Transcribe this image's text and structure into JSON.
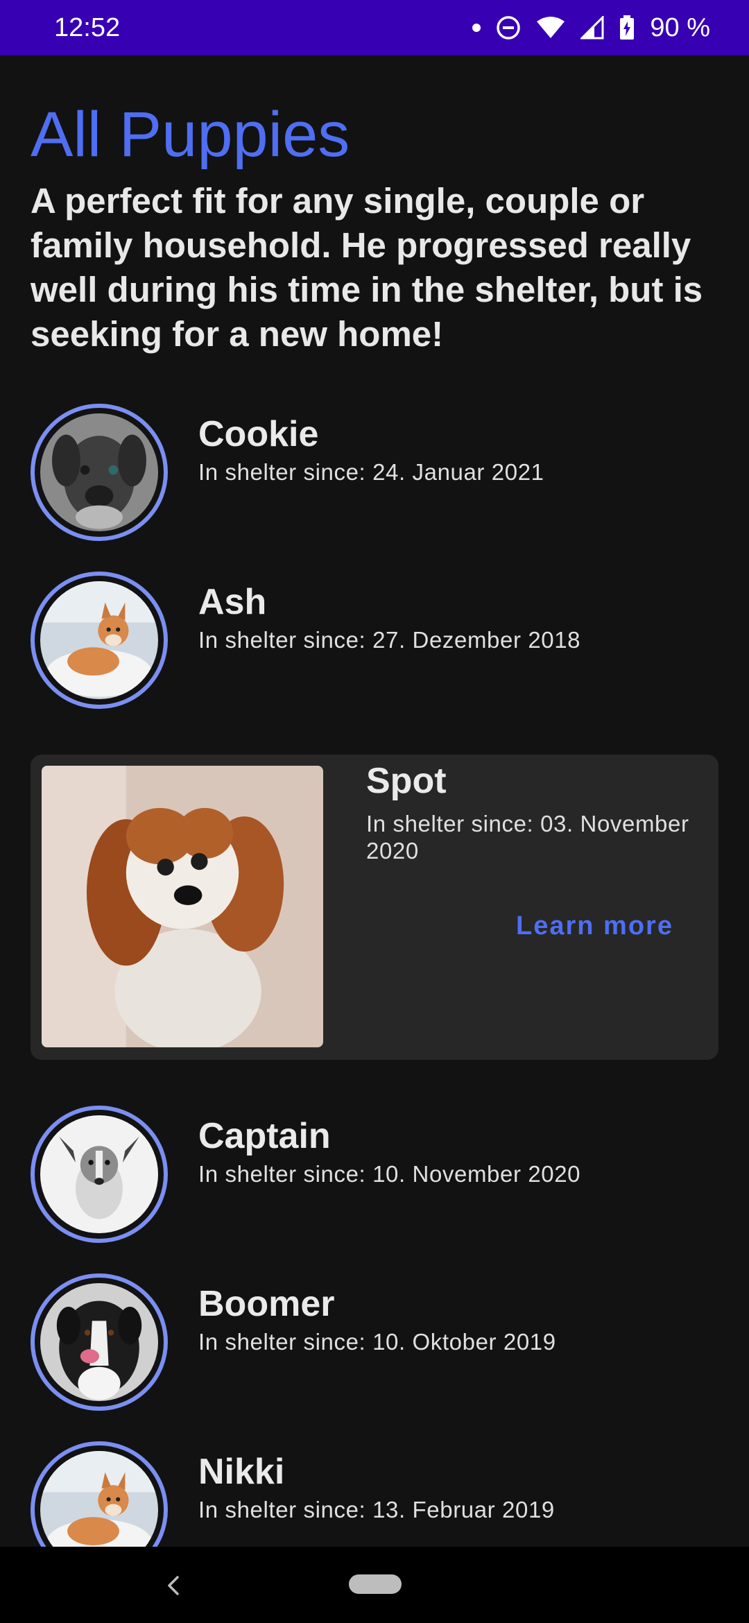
{
  "status_bar": {
    "time": "12:52",
    "battery": "90 %"
  },
  "header": {
    "title": "All Puppies",
    "description": "A perfect fit for any single, couple or family household. He progressed really well during his time in the shelter, but is seeking for a new home!"
  },
  "puppies": [
    {
      "name": "Cookie",
      "since": "In shelter since: 24. Januar 2021"
    },
    {
      "name": "Ash",
      "since": "In shelter since: 27. Dezember 2018"
    },
    {
      "name": "Spot",
      "since": "In shelter since: 03. November 2020",
      "action": "Learn more"
    },
    {
      "name": "Captain",
      "since": "In shelter since: 10. November 2020"
    },
    {
      "name": "Boomer",
      "since": "In shelter since: 10. Oktober 2019"
    },
    {
      "name": "Nikki",
      "since": "In shelter since: 13. Februar 2019"
    }
  ],
  "colors": {
    "status_bar": "#3700b3",
    "accent": "#4f6ef2",
    "avatar_ring": "#7b8ff2",
    "background": "#121212",
    "card": "#272727"
  },
  "icons": [
    "notification-dot-icon",
    "do-not-disturb-icon",
    "wifi-icon",
    "cell-signal-icon",
    "battery-charging-icon",
    "back-icon",
    "home-pill-icon"
  ]
}
